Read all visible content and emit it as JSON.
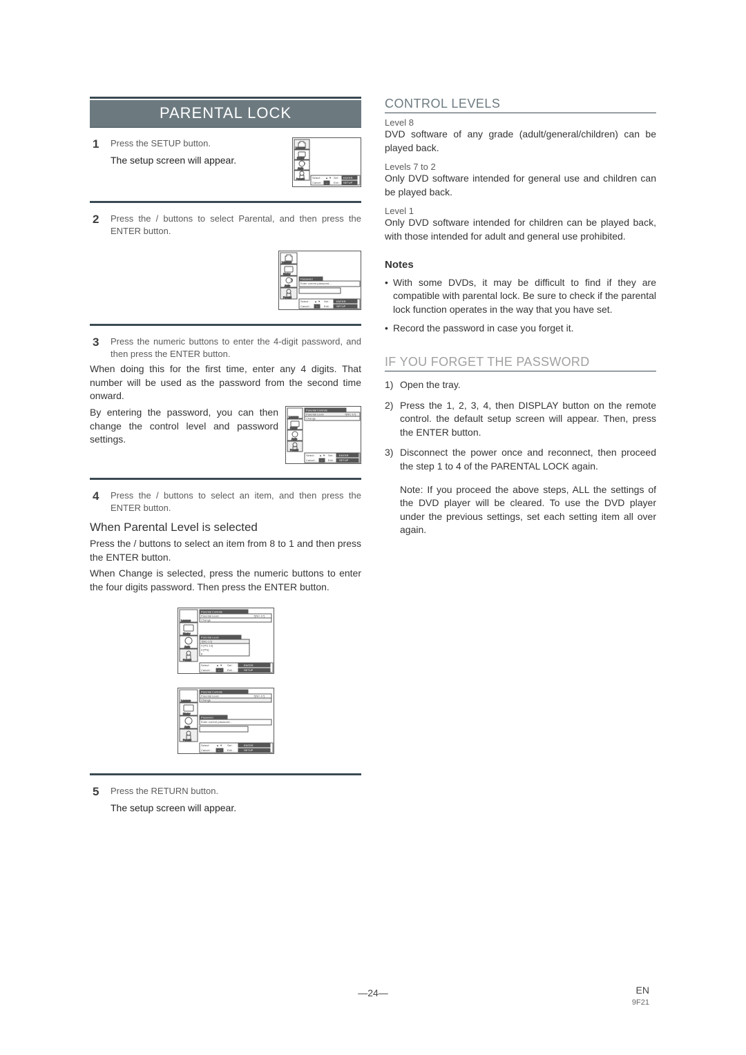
{
  "title": "PARENTAL LOCK",
  "steps": {
    "s1": {
      "num": "1",
      "grey": "Press the SETUP button.",
      "black": "The setup screen will appear."
    },
    "s2": {
      "num": "2",
      "grey": "Press the    /    buttons to select Parental, and then press the ENTER button."
    },
    "s3": {
      "num": "3",
      "grey": "Press the numeric buttons to enter the 4-digit password, and then press the ENTER button."
    },
    "s3_para1": "When doing this for the first time, enter any 4 digits. That number will be used as the password from the second time onward.",
    "s3_para2": "By entering the password, you can then change the control level and password settings.",
    "s4": {
      "num": "4",
      "grey": "Press the    /    buttons to select an item, and then press the ENTER button."
    },
    "subhead_parental_level": "When Parental Level is selected",
    "s4_para1": "Press the  /  buttons to select an item from  8 to 1 and then press the ENTER button.",
    "s4_para2": "When Change is selected, press the numeric buttons to enter the four digits password. Then press the ENTER button.",
    "s5": {
      "num": "5",
      "grey": "Press the RETURN button.",
      "black": "The setup screen will appear."
    }
  },
  "screens": {
    "sidebar": {
      "language": "Language",
      "display": "Display",
      "audio": "Audio",
      "parental": "Parental"
    },
    "nav": {
      "select": "Select :",
      "set": "Set :",
      "cancel": "Cancel :",
      "exit": "Exit :",
      "enter": "ENTER",
      "return": "←",
      "setup": "SETUP",
      "arrows_lr": "◄ ►",
      "arrows_ud": "▲ ▼"
    },
    "pwd": {
      "header": "Password",
      "hint": "Enter current password..."
    },
    "pc": {
      "header": "Parental Controls",
      "row_level": "Parental Level",
      "value_level": "7[NC-17]",
      "row_change": "Change"
    },
    "lvl": {
      "box_header": "Parental Level",
      "opt1": "7[NC-17]",
      "opt2": "4 [PG-13]",
      "opt3": "3 [PG]",
      "opt4": "8"
    }
  },
  "right": {
    "control_levels_title": "CONTROL LEVELS",
    "level8_head": "Level 8",
    "level8_body": "DVD software of any grade (adult/general/children) can be played back.",
    "level72_head": "Levels 7 to 2",
    "level72_body": "Only DVD software intended for general use and children can be played back.",
    "level1_head": "Level 1",
    "level1_body": "Only DVD software intended for children can be played back, with those intended for adult and general use prohibited.",
    "notes_head": "Notes",
    "note1": "With some DVDs, it may be difficult to find if they are compatible with parental lock. Be sure to check if the parental lock function operates in the way that you have set.",
    "note2": "Record the password in case you forget it.",
    "forgot_title": "IF YOU FORGET THE PASSWORD",
    "f1": "Open the tray.",
    "f2": "Press the 1, 2, 3, 4, then DISPLAY button on the remote control. the default setup screen will appear. Then, press the ENTER button.",
    "f3": "Disconnect the power once and reconnect, then proceed the step 1 to 4 of the PARENTAL LOCK again.",
    "f_note": "Note: If  you proceed the above steps, ALL the settings of the DVD player will be cleared. To use the DVD player under the previous settings, set each setting item all over again."
  },
  "footer": {
    "page": "24",
    "en": "EN",
    "code": "9F21"
  }
}
